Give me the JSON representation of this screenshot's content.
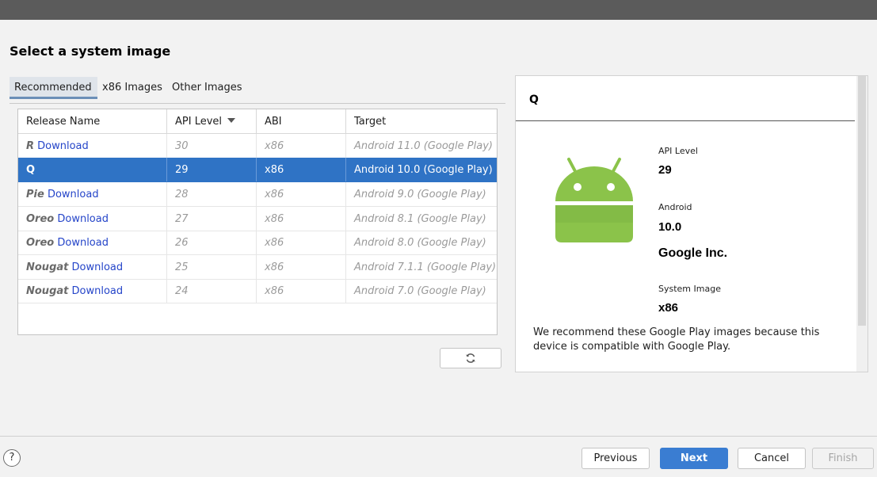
{
  "page_title": "Select a system image",
  "tabs": [
    {
      "label": "Recommended",
      "active": true
    },
    {
      "label": "x86 Images",
      "active": false
    },
    {
      "label": "Other Images",
      "active": false
    }
  ],
  "table": {
    "columns": [
      "Release Name",
      "API Level",
      "ABI",
      "Target"
    ],
    "sort_column": "API Level",
    "rows": [
      {
        "name": "R",
        "download": "Download",
        "api": "30",
        "abi": "x86",
        "target": "Android 11.0 (Google Play)",
        "selected": false
      },
      {
        "name": "Q",
        "download": "",
        "api": "29",
        "abi": "x86",
        "target": "Android 10.0 (Google Play)",
        "selected": true
      },
      {
        "name": "Pie",
        "download": "Download",
        "api": "28",
        "abi": "x86",
        "target": "Android 9.0 (Google Play)",
        "selected": false
      },
      {
        "name": "Oreo",
        "download": "Download",
        "api": "27",
        "abi": "x86",
        "target": "Android 8.1 (Google Play)",
        "selected": false
      },
      {
        "name": "Oreo",
        "download": "Download",
        "api": "26",
        "abi": "x86",
        "target": "Android 8.0 (Google Play)",
        "selected": false
      },
      {
        "name": "Nougat",
        "download": "Download",
        "api": "25",
        "abi": "x86",
        "target": "Android 7.1.1 (Google Play)",
        "selected": false
      },
      {
        "name": "Nougat",
        "download": "Download",
        "api": "24",
        "abi": "x86",
        "target": "Android 7.0 (Google Play)",
        "selected": false
      }
    ]
  },
  "refresh_icon": "refresh-icon",
  "details": {
    "title": "Q",
    "api_level_label": "API Level",
    "api_level": "29",
    "android_label": "Android",
    "android_version": "10.0",
    "vendor": "Google Inc.",
    "system_image_label": "System Image",
    "system_image": "x86",
    "description": "We recommend these Google Play images because this device is compatible with Google Play.",
    "logo_color": "#8bc34a"
  },
  "footer": {
    "help": "?",
    "previous": "Previous",
    "next": "Next",
    "cancel": "Cancel",
    "finish": "Finish"
  },
  "colors": {
    "selection": "#2f73c5",
    "primary_button": "#3a7dd2",
    "link": "#2545c9"
  }
}
